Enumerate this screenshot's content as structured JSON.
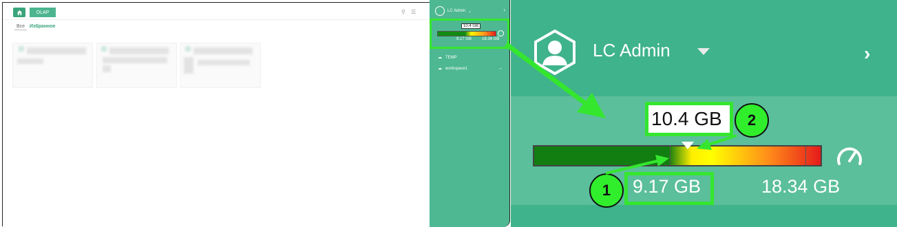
{
  "left_panel": {
    "tab_label": "OLAP",
    "filters": [
      "Все",
      "Избранное"
    ]
  },
  "sidebar": {
    "user_name": "LC Admin",
    "usage_label": "10.4 GB",
    "usage_min_label": "9.17 GB",
    "usage_max_label": "18.34 GB",
    "workspaces": [
      "TEMP",
      "workspace1"
    ]
  },
  "zoom": {
    "user_name": "LC Admin",
    "usage_label": "10.4 GB",
    "usage_min_label": "9.17 GB",
    "usage_max_label": "18.34 GB",
    "badges": [
      "1",
      "2"
    ]
  },
  "colors": {
    "sidebar_green": "#4db892",
    "highlight_green": "#35e62f",
    "bar_green": "#127d10",
    "bar_yellow": "#ffff00",
    "bar_red": "#e51b1b"
  },
  "icons": [
    "home-icon",
    "search-icon",
    "menu-icon",
    "avatar-icon",
    "caret-down-icon",
    "chevron-right-icon",
    "gauge-icon",
    "cloud-icon",
    "arrow-right-icon"
  ]
}
